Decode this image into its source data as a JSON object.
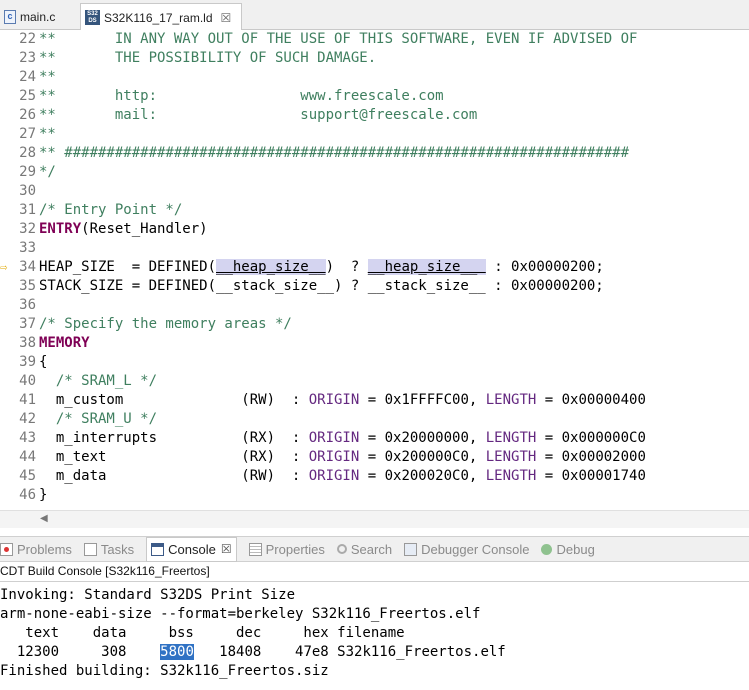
{
  "editor_tabs": [
    {
      "label": "main.c",
      "icon": "c-file-icon",
      "active": false
    },
    {
      "label": "S32K116_17_ram.ld",
      "icon": "s32-file-icon",
      "active": true,
      "close": "☒"
    }
  ],
  "s32_icon_text": [
    "S32",
    "DS"
  ],
  "code_lines": [
    {
      "num": "22",
      "parts": [
        {
          "t": "**       IN ANY WAY OUT OF THE USE OF THIS SOFTWARE, EVEN IF ADVISED OF",
          "c": "cm"
        }
      ]
    },
    {
      "num": "23",
      "parts": [
        {
          "t": "**       THE POSSIBILITY OF SUCH DAMAGE.",
          "c": "cm"
        }
      ]
    },
    {
      "num": "24",
      "parts": [
        {
          "t": "**",
          "c": "cm"
        }
      ]
    },
    {
      "num": "25",
      "parts": [
        {
          "t": "**       http:                 www.freescale.com",
          "c": "cm"
        }
      ]
    },
    {
      "num": "26",
      "parts": [
        {
          "t": "**       mail:                 support@freescale.com",
          "c": "cm"
        }
      ]
    },
    {
      "num": "27",
      "parts": [
        {
          "t": "**",
          "c": "cm"
        }
      ]
    },
    {
      "num": "28",
      "parts": [
        {
          "t": "** ###################################################################",
          "c": "cm"
        }
      ]
    },
    {
      "num": "29",
      "parts": [
        {
          "t": "*/",
          "c": "cm"
        }
      ]
    },
    {
      "num": "30",
      "parts": [
        {
          "t": "",
          "c": ""
        }
      ]
    },
    {
      "num": "31",
      "parts": [
        {
          "t": "/* Entry Point */",
          "c": "cm"
        }
      ]
    },
    {
      "num": "32",
      "parts": [
        {
          "t": "ENTRY",
          "c": "kw"
        },
        {
          "t": "(Reset_Handler)",
          "c": ""
        }
      ]
    },
    {
      "num": "33",
      "parts": [
        {
          "t": "",
          "c": ""
        }
      ]
    },
    {
      "num": "34",
      "marker": true,
      "parts": [
        {
          "t": "HEAP_SIZE  = DEFINED(",
          "c": ""
        },
        {
          "t": "__heap_size__",
          "c": "hl ul"
        },
        {
          "t": ")  ? ",
          "c": ""
        },
        {
          "t": "__heap_size__ ",
          "c": "hl ul"
        },
        {
          "t": " : 0x00000200;",
          "c": ""
        }
      ]
    },
    {
      "num": "35",
      "parts": [
        {
          "t": "STACK_SIZE = DEFINED(__stack_size__) ? __stack_size__ : 0x00000200;",
          "c": ""
        }
      ]
    },
    {
      "num": "36",
      "parts": [
        {
          "t": "",
          "c": ""
        }
      ]
    },
    {
      "num": "37",
      "parts": [
        {
          "t": "/* Specify the memory areas */",
          "c": "cm"
        }
      ]
    },
    {
      "num": "38",
      "parts": [
        {
          "t": "MEMORY",
          "c": "kw"
        }
      ]
    },
    {
      "num": "39",
      "parts": [
        {
          "t": "{",
          "c": ""
        }
      ]
    },
    {
      "num": "40",
      "parts": [
        {
          "t": "  /* SRAM_L */",
          "c": "cm"
        }
      ]
    },
    {
      "num": "41",
      "parts": [
        {
          "t": "  m_custom              (RW)  : ",
          "c": ""
        },
        {
          "t": "ORIGIN",
          "c": "mac"
        },
        {
          "t": " = 0x1FFFFC00, ",
          "c": ""
        },
        {
          "t": "LENGTH",
          "c": "mac"
        },
        {
          "t": " = 0x00000400",
          "c": ""
        }
      ]
    },
    {
      "num": "42",
      "parts": [
        {
          "t": "  /* SRAM_U */",
          "c": "cm"
        }
      ]
    },
    {
      "num": "43",
      "parts": [
        {
          "t": "  m_interrupts          (RX)  : ",
          "c": ""
        },
        {
          "t": "ORIGIN",
          "c": "mac"
        },
        {
          "t": " = 0x20000000, ",
          "c": ""
        },
        {
          "t": "LENGTH",
          "c": "mac"
        },
        {
          "t": " = 0x000000C0",
          "c": ""
        }
      ]
    },
    {
      "num": "44",
      "parts": [
        {
          "t": "  m_text                (RX)  : ",
          "c": ""
        },
        {
          "t": "ORIGIN",
          "c": "mac"
        },
        {
          "t": " = 0x200000C0, ",
          "c": ""
        },
        {
          "t": "LENGTH",
          "c": "mac"
        },
        {
          "t": " = 0x00002000",
          "c": ""
        }
      ]
    },
    {
      "num": "45",
      "parts": [
        {
          "t": "  m_data                (RW)  : ",
          "c": ""
        },
        {
          "t": "ORIGIN",
          "c": "mac"
        },
        {
          "t": " = 0x200020C0, ",
          "c": ""
        },
        {
          "t": "LENGTH",
          "c": "mac"
        },
        {
          "t": " = 0x00001740",
          "c": ""
        }
      ]
    },
    {
      "num": "46",
      "parts": [
        {
          "t": "}",
          "c": ""
        }
      ]
    }
  ],
  "scroll_left_glyph": "◀",
  "console_tabs": [
    {
      "label": "Problems",
      "icon": "i-problems",
      "name": "problems"
    },
    {
      "label": "Tasks",
      "icon": "i-tasks",
      "name": "tasks"
    },
    {
      "label": "Console",
      "icon": "i-console",
      "name": "console",
      "active": true,
      "close": "☒"
    },
    {
      "label": "Properties",
      "icon": "i-props",
      "name": "properties"
    },
    {
      "label": "Search",
      "icon": "i-search",
      "name": "search"
    },
    {
      "label": "Debugger Console",
      "icon": "i-dbg",
      "name": "debugger-console"
    },
    {
      "label": "Debug",
      "icon": "i-bug",
      "name": "debug"
    }
  ],
  "console_title": "CDT Build Console [S32k116_Freertos]",
  "console_lines": [
    {
      "parts": [
        {
          "t": "Invoking: Standard S32DS Print Size",
          "c": ""
        }
      ]
    },
    {
      "parts": [
        {
          "t": "arm-none-eabi-size --format=berkeley S32k116_Freertos.elf",
          "c": ""
        }
      ]
    },
    {
      "parts": [
        {
          "t": "   text    data     bss     dec     hex filename",
          "c": ""
        }
      ]
    },
    {
      "parts": [
        {
          "t": "  12300     308    ",
          "c": ""
        },
        {
          "t": "5800",
          "c": "sel"
        },
        {
          "t": "   18408    47e8 S32k116_Freertos.elf",
          "c": ""
        }
      ]
    },
    {
      "parts": [
        {
          "t": "Finished building: S32k116_Freertos.siz",
          "c": ""
        }
      ]
    }
  ]
}
